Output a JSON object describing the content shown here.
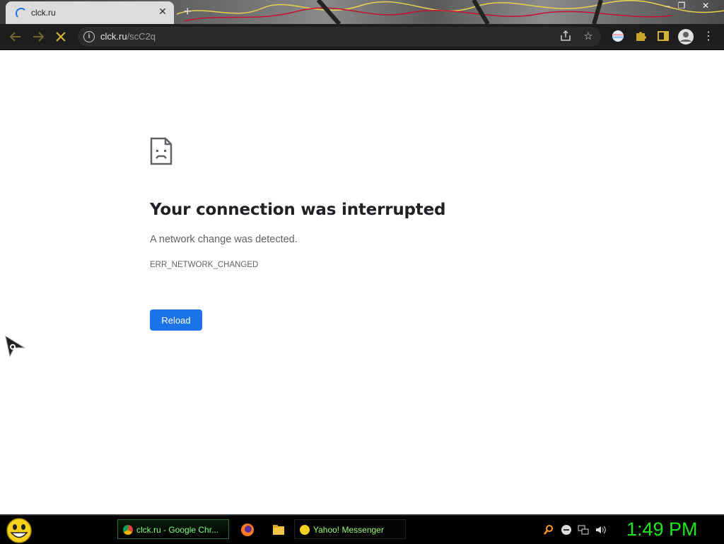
{
  "browser": {
    "tab_title": "clck.ru",
    "new_tab": "+",
    "window_controls": {
      "minimize": "–",
      "restore": "❐",
      "close": "✕"
    },
    "address": {
      "host": "clck.ru",
      "path": "/scC2q"
    }
  },
  "page": {
    "title": "Your connection was interrupted",
    "description": "A network change was detected.",
    "error_code": "ERR_NETWORK_CHANGED",
    "reload_label": "Reload"
  },
  "taskbar": {
    "tasks": [
      {
        "label": "clck.ru - Google Chr...",
        "icon": "chrome-icon"
      },
      {
        "label": "Yahoo! Messenger",
        "icon": "yahoo-messenger-icon"
      }
    ],
    "quick_launch": [
      "firefox-icon",
      "folder-icon"
    ],
    "tray": [
      "search-icon",
      "status-icon",
      "network-icon",
      "volume-icon"
    ],
    "clock": "1:49 PM"
  },
  "colors": {
    "accent": "#1a73e8",
    "taskbar_text": "#7dff7d",
    "clock": "#1ee61e"
  }
}
